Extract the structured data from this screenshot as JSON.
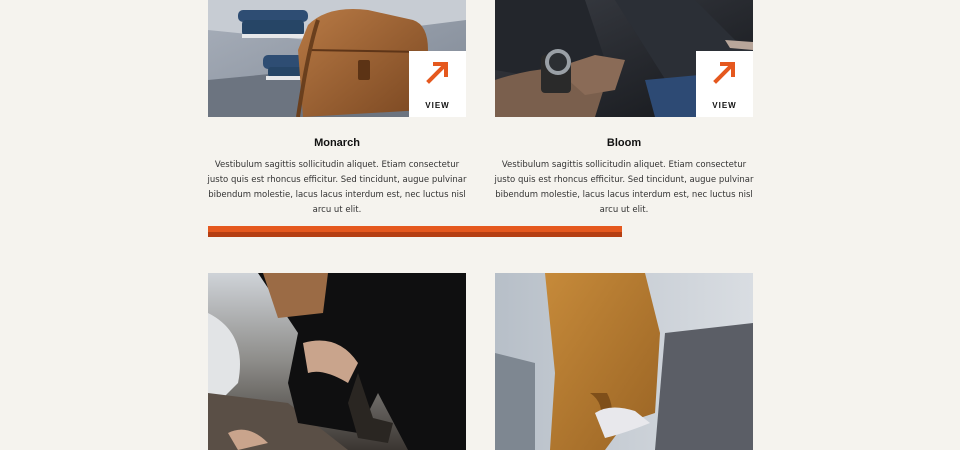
{
  "colors": {
    "background": "#f5f3ee",
    "accent": "#e5581e",
    "accent_dark": "#b53e12"
  },
  "cards": [
    {
      "title": "Monarch",
      "description": "Vestibulum sagittis sollicitudin aliquet. Etiam consectetur justo quis est rhoncus efficitur. Sed tincidunt, augue pulvinar bibendum molestie, lacus lacus interdum est, nec luctus nisl arcu ut elit.",
      "view_label": "VIEW",
      "icon": "arrow-up-right-icon",
      "image": "leather-bag-photo"
    },
    {
      "title": "Bloom",
      "description": "Vestibulum sagittis sollicitudin aliquet. Etiam consectetur justo quis est rhoncus efficitur. Sed tincidunt, augue pulvinar bibendum molestie, lacus lacus interdum est, nec luctus nisl arcu ut elit.",
      "view_label": "VIEW",
      "icon": "arrow-up-right-icon",
      "image": "wristwatch-photo"
    },
    {
      "image": "crouching-woman-photo"
    },
    {
      "image": "mustard-cardigan-photo"
    }
  ]
}
